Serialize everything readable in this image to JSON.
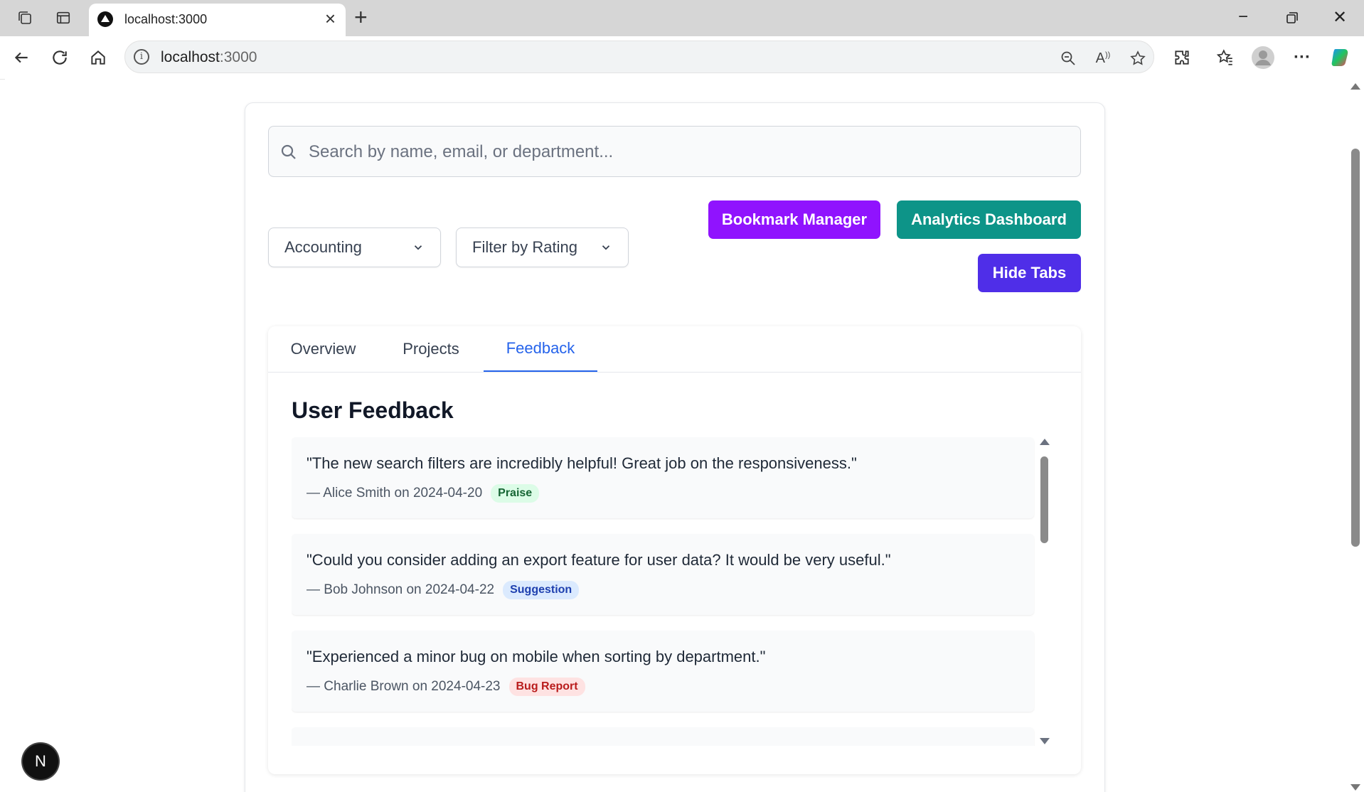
{
  "browser": {
    "tab_title": "localhost:3000",
    "url_host": "localhost",
    "url_port": ":3000"
  },
  "search": {
    "placeholder": "Search by name, email, or department...",
    "value": ""
  },
  "filters": {
    "department_selected": "Accounting",
    "rating_selected": "Filter by Rating"
  },
  "actions": {
    "bookmark_manager": "Bookmark Manager",
    "analytics_dashboard": "Analytics Dashboard",
    "hide_tabs": "Hide Tabs"
  },
  "tabs": [
    {
      "label": "Overview",
      "active": false
    },
    {
      "label": "Projects",
      "active": false
    },
    {
      "label": "Feedback",
      "active": true
    }
  ],
  "feedback": {
    "heading": "User Feedback",
    "items": [
      {
        "quote": "\"The new search filters are incredibly helpful! Great job on the responsiveness.\"",
        "meta": "— Alice Smith on 2024-04-20",
        "badge": "Praise"
      },
      {
        "quote": "\"Could you consider adding an export feature for user data? It would be very useful.\"",
        "meta": "— Bob Johnson on 2024-04-22",
        "badge": "Suggestion"
      },
      {
        "quote": "\"Experienced a minor bug on mobile when sorting by department.\"",
        "meta": "— Charlie Brown on 2024-04-23",
        "badge": "Bug Report"
      }
    ]
  },
  "dev_badge": "N",
  "colors": {
    "bookmark_button": "#9013fe",
    "analytics_button": "#0d9488",
    "hide_tabs_button": "#4f2ee8",
    "active_tab": "#2563eb"
  }
}
